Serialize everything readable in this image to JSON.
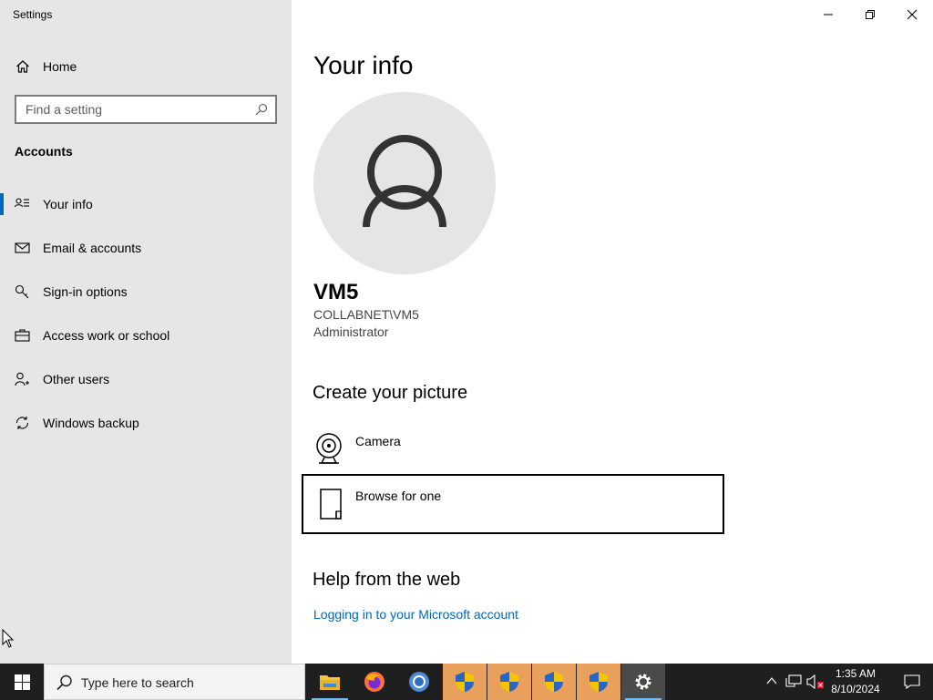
{
  "window": {
    "title": "Settings",
    "controls": [
      "minimize-icon",
      "restore-icon",
      "close-icon"
    ]
  },
  "sidebar": {
    "home_label": "Home",
    "search_placeholder": "Find a setting",
    "section_heading": "Accounts",
    "items": [
      {
        "label": "Your info",
        "icon": "person-card-icon",
        "active": true
      },
      {
        "label": "Email & accounts",
        "icon": "mail-icon",
        "active": false
      },
      {
        "label": "Sign-in options",
        "icon": "key-icon",
        "active": false
      },
      {
        "label": "Access work or school",
        "icon": "briefcase-icon",
        "active": false
      },
      {
        "label": "Other users",
        "icon": "person-add-icon",
        "active": false
      },
      {
        "label": "Windows backup",
        "icon": "sync-icon",
        "active": false
      }
    ]
  },
  "main": {
    "title": "Your info",
    "user": {
      "name": "VM5",
      "domain": "COLLABNET\\VM5",
      "role": "Administrator"
    },
    "create_picture": {
      "heading": "Create your picture",
      "options": [
        {
          "label": "Camera",
          "icon": "camera-icon"
        },
        {
          "label": "Browse for one",
          "icon": "file-icon"
        }
      ]
    },
    "help": {
      "heading": "Help from the web",
      "link": "Logging in to your Microsoft account"
    }
  },
  "taskbar": {
    "search_placeholder": "Type here to search",
    "apps": [
      "file-explorer-icon",
      "firefox-icon",
      "chrome-icon",
      "shield-icon",
      "shield-icon",
      "shield-icon",
      "shield-icon",
      "settings-gear-icon"
    ],
    "tray": [
      "chevron-up-icon",
      "network-icon",
      "volume-muted-icon"
    ],
    "time": "1:35 AM",
    "date": "8/10/2024"
  },
  "colors": {
    "sidebar_bg": "#e6e6e6",
    "accent": "#0067c0",
    "link": "#0067b8",
    "taskbar_bg": "#1f1f1f",
    "highlight_app": "#e8a05c"
  }
}
